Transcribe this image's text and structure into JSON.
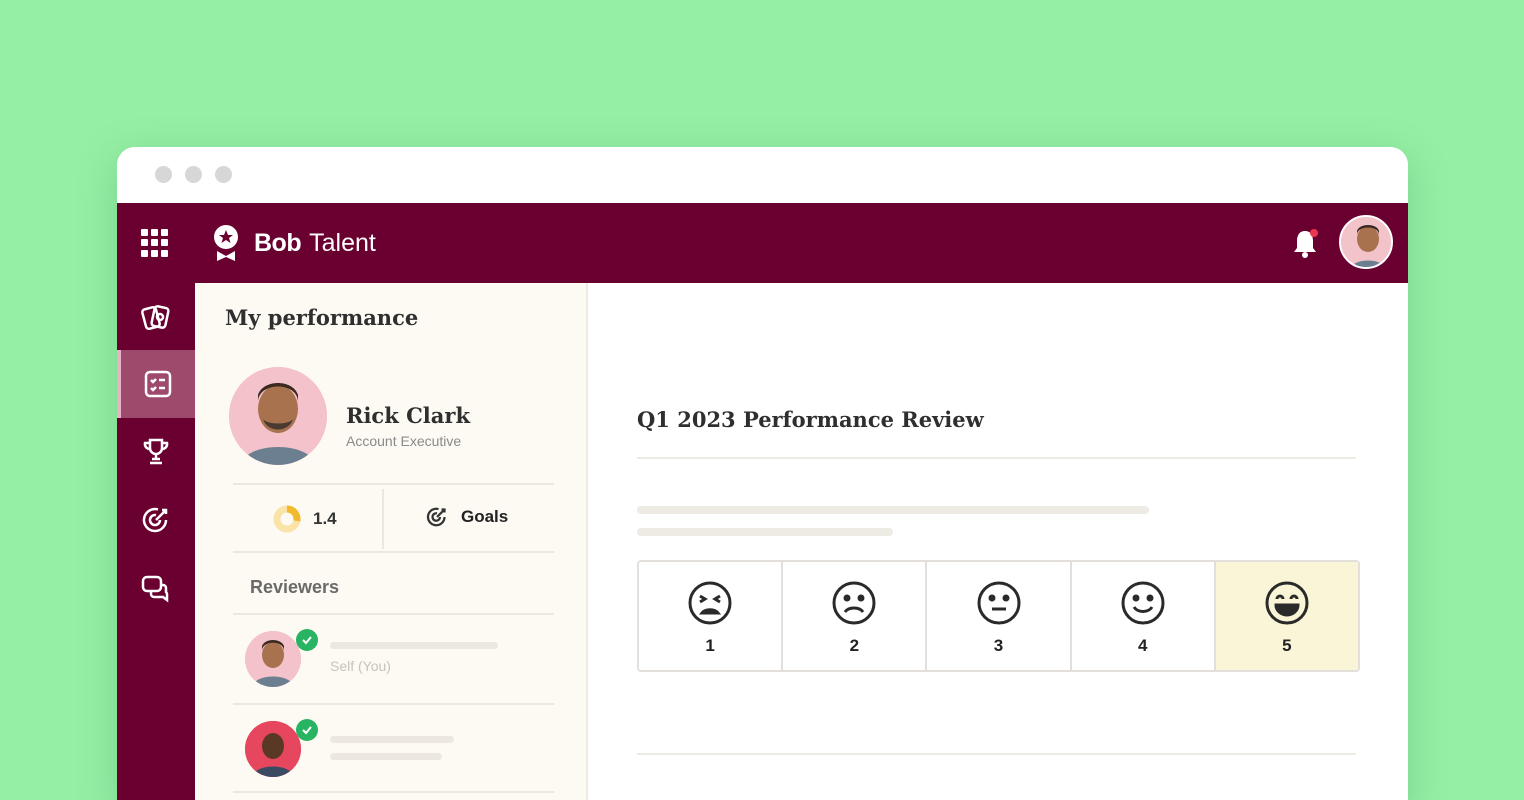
{
  "app": {
    "brand_name": "Bob",
    "brand_product": "Talent",
    "icons": [
      "apps-grid-icon",
      "bob-logo-icon",
      "bell-icon"
    ],
    "notification_dot_color": "#e8384f",
    "theme_color": "#6a0030"
  },
  "sidebar": {
    "items": [
      {
        "name": "cards",
        "icon": "cards-icon",
        "active": false
      },
      {
        "name": "tasks",
        "icon": "checklist-icon",
        "active": true
      },
      {
        "name": "achievements",
        "icon": "trophy-icon",
        "active": false
      },
      {
        "name": "goals",
        "icon": "target-icon",
        "active": false
      },
      {
        "name": "feedback",
        "icon": "chat-bubbles-icon",
        "active": false
      }
    ]
  },
  "profile_panel": {
    "title": "My performance",
    "user_name": "Rick Clark",
    "user_role": "Account Executive",
    "score": "1.4",
    "score_fraction": 0.28,
    "goals_label": "Goals",
    "reviewers_label": "Reviewers",
    "reviewers": [
      {
        "label": "Self (You)",
        "status": "complete"
      },
      {
        "label": "",
        "status": "complete"
      }
    ]
  },
  "review": {
    "title": "Q1 2023 Performance Review",
    "selected_rating": 5,
    "options": [
      {
        "value": "1",
        "icon": "squinting-sad-face-icon"
      },
      {
        "value": "2",
        "icon": "frown-face-icon"
      },
      {
        "value": "3",
        "icon": "neutral-face-icon"
      },
      {
        "value": "4",
        "icon": "smile-face-icon"
      },
      {
        "value": "5",
        "icon": "grin-face-icon"
      }
    ]
  }
}
